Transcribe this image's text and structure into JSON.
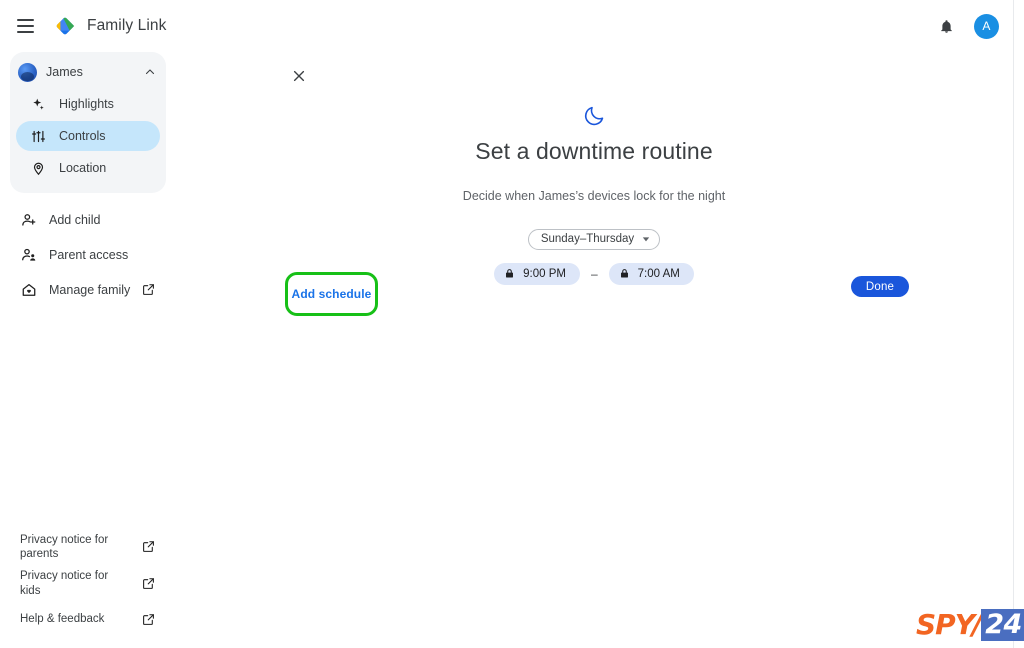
{
  "app": {
    "title": "Family Link",
    "logo_icon": "family-link-diamond-logo",
    "menu_icon": "hamburger-menu-icon",
    "notifications_icon": "bell-icon",
    "account_initial": "A",
    "accent_blue": "#1a73e8",
    "primary_button_blue": "#1a56db",
    "highlight_green": "#17c017"
  },
  "sidebar": {
    "child": {
      "name": "James",
      "avatar_icon": "child-avatar",
      "collapse_icon": "chevron-up-icon",
      "items": [
        {
          "label": "Highlights",
          "icon": "sparkle-icon",
          "active": false
        },
        {
          "label": "Controls",
          "icon": "tune-sliders-icon",
          "active": true
        },
        {
          "label": "Location",
          "icon": "location-pin-icon",
          "active": false
        }
      ]
    },
    "main_items": [
      {
        "label": "Add child",
        "icon": "person-add-icon",
        "external": false
      },
      {
        "label": "Parent access",
        "icon": "supervised-person-icon",
        "external": false
      },
      {
        "label": "Manage family",
        "icon": "home-heart-icon",
        "external": true
      }
    ],
    "footer_items": [
      {
        "label": "Privacy notice for parents",
        "external": true
      },
      {
        "label": "Privacy notice for kids",
        "external": true
      },
      {
        "label": "Help & feedback",
        "external": true
      }
    ],
    "external_link_icon": "open-in-new-icon"
  },
  "main": {
    "close_icon": "close-x-icon",
    "moon_icon": "crescent-moon-icon",
    "title": "Set a downtime routine",
    "subtitle": "Decide when James’s devices lock for the night",
    "day_range": {
      "value": "Sunday–Thursday",
      "caret_icon": "caret-down-icon"
    },
    "schedule": {
      "start_time": "9:00 PM",
      "end_time": "7:00 AM",
      "separator": "–",
      "lock_icon": "lock-icon"
    },
    "add_schedule_label": "Add schedule",
    "done_label": "Done"
  },
  "watermark": {
    "part1": "SPY",
    "slash": "/",
    "part2": "24",
    "orange": "#f26522",
    "blue": "#4a6ec0"
  }
}
